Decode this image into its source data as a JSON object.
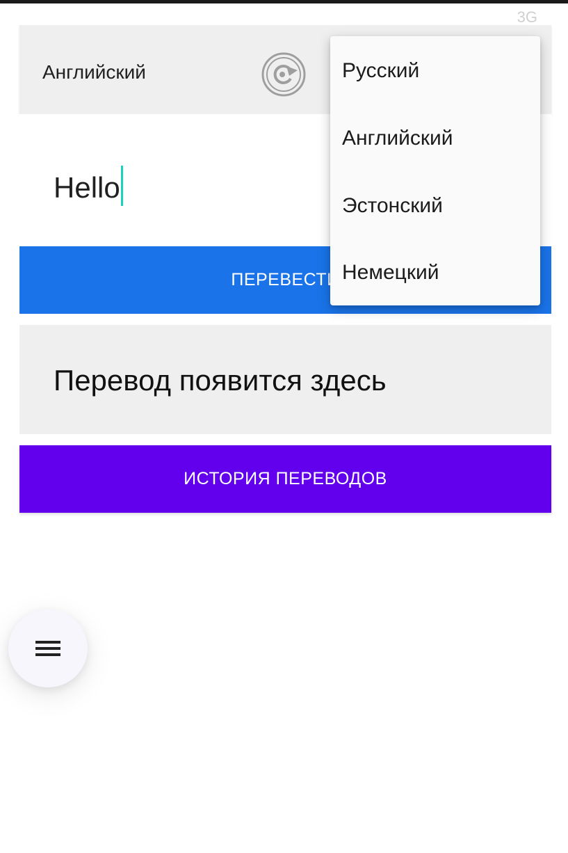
{
  "status_bar": {
    "left_text": "",
    "right_text": "3G"
  },
  "language_bar": {
    "source_language": "Английский"
  },
  "input": {
    "value": "Hello"
  },
  "buttons": {
    "translate_label": "ПЕРЕВЕСТИ",
    "history_label": "ИСТОРИЯ ПЕРЕВОДОВ"
  },
  "result": {
    "placeholder": "Перевод появится здесь"
  },
  "dropdown": {
    "items": [
      {
        "label": "Русский"
      },
      {
        "label": "Английский"
      },
      {
        "label": "Эстонский"
      },
      {
        "label": "Немецкий"
      }
    ]
  },
  "icons": {
    "swap": "refresh-swap-icon",
    "menu": "menu-icon"
  },
  "colors": {
    "translate_button": "#1a73e8",
    "history_button": "#6200ee",
    "caret": "#1ad1c0"
  }
}
